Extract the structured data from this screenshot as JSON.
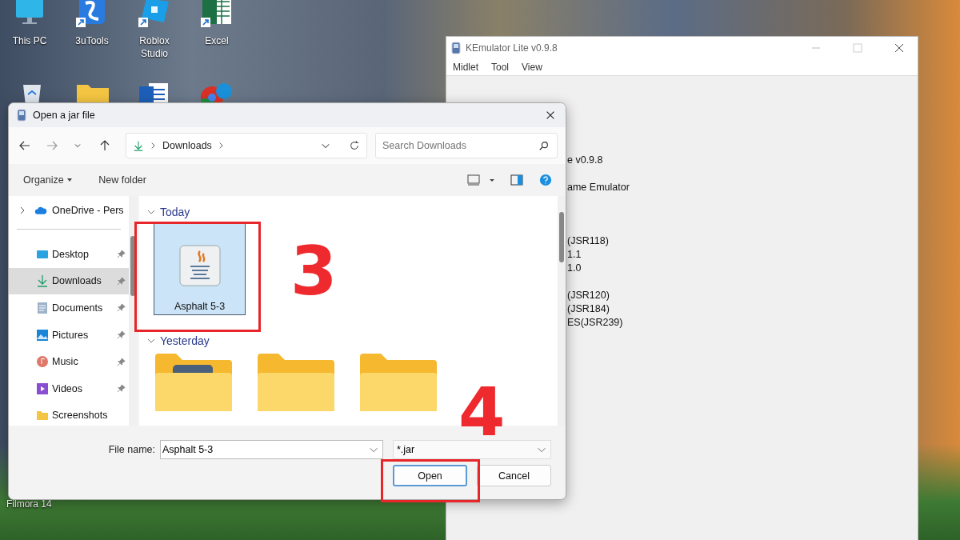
{
  "desktop": {
    "icons": [
      {
        "label": "This PC",
        "kind": "pc",
        "shortcut": false
      },
      {
        "label": "3uTools",
        "kind": "tools",
        "shortcut": true
      },
      {
        "label": "Roblox Studio",
        "kind": "roblox",
        "shortcut": true
      },
      {
        "label": "Excel",
        "kind": "excel",
        "shortcut": true
      }
    ],
    "bottom_label": "Filmora 14"
  },
  "emulator_window": {
    "title": "KEmulator Lite v0.9.8",
    "menu": [
      "Midlet",
      "Tool",
      "View"
    ],
    "about_lines": [
      "e v0.9.8",
      "ame Emulator"
    ],
    "api_lines_1": [
      "(JSR118)",
      "1.1",
      "1.0"
    ],
    "api_lines_2": [
      "(JSR120)",
      "(JSR184)",
      "ES(JSR239)"
    ]
  },
  "dialog": {
    "title": "Open a jar file",
    "address": {
      "segments": [
        "Downloads"
      ]
    },
    "search": {
      "placeholder": "Search Downloads"
    },
    "toolbar": {
      "organize": "Organize",
      "new_folder": "New folder"
    },
    "nav_pane": {
      "cloud": {
        "label": "OneDrive - Pers",
        "expanded": false
      },
      "items": [
        {
          "label": "Desktop",
          "kind": "desktop",
          "pinned": true,
          "selected": false
        },
        {
          "label": "Downloads",
          "kind": "downloads",
          "pinned": true,
          "selected": true
        },
        {
          "label": "Documents",
          "kind": "documents",
          "pinned": true,
          "selected": false
        },
        {
          "label": "Pictures",
          "kind": "pictures",
          "pinned": true,
          "selected": false
        },
        {
          "label": "Music",
          "kind": "music",
          "pinned": true,
          "selected": false
        },
        {
          "label": "Videos",
          "kind": "videos",
          "pinned": true,
          "selected": false
        },
        {
          "label": "Screenshots",
          "kind": "folder",
          "pinned": false,
          "selected": false
        }
      ]
    },
    "groups": [
      {
        "label": "Today",
        "expanded": true,
        "items": [
          {
            "name": "Asphalt 5-3",
            "kind": "jar",
            "selected": true
          }
        ]
      },
      {
        "label": "Yesterday",
        "expanded": true,
        "items": [
          {
            "kind": "folder_thumb",
            "selected": false
          },
          {
            "kind": "folder",
            "selected": false
          },
          {
            "kind": "folder",
            "selected": false
          }
        ]
      }
    ],
    "file_name": {
      "label": "File name:",
      "value": "Asphalt 5-3"
    },
    "file_type": {
      "value": "*.jar"
    },
    "buttons": [
      {
        "label": "Open",
        "default": true
      },
      {
        "label": "Cancel",
        "default": false
      }
    ]
  },
  "annotations": [
    {
      "step": "3"
    },
    {
      "step": "4"
    }
  ]
}
